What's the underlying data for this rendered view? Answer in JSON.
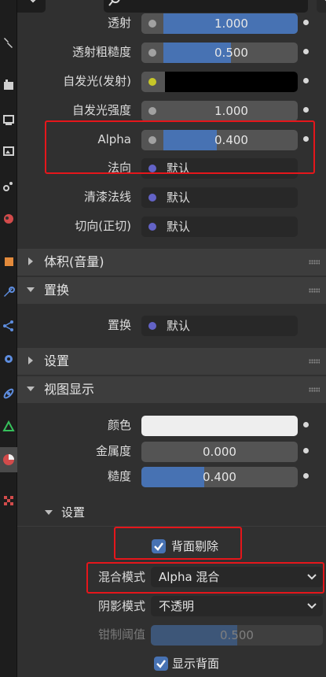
{
  "sidebar": {
    "tabs": [
      {
        "icon": "tool-icon",
        "active": false
      },
      {
        "icon": "render-icon",
        "active": false
      },
      {
        "icon": "output-icon",
        "active": false
      },
      {
        "icon": "view-layer-icon",
        "active": false
      },
      {
        "icon": "scene-icon",
        "active": false
      },
      {
        "icon": "world-icon",
        "active": false
      },
      {
        "icon": "object-icon",
        "active": false
      },
      {
        "icon": "modifier-icon",
        "active": false
      },
      {
        "icon": "particles-icon",
        "active": false
      },
      {
        "icon": "physics-icon",
        "active": false
      },
      {
        "icon": "constraints-icon",
        "active": false
      },
      {
        "icon": "data-icon",
        "active": false
      },
      {
        "icon": "material-icon",
        "active": true
      },
      {
        "icon": "texture-icon",
        "active": false
      }
    ]
  },
  "header": {
    "search_icon": "search-icon"
  },
  "surface": {
    "transmission": {
      "label": "透射",
      "value": "1.000",
      "fraction": 1.0
    },
    "transmission_roughness": {
      "label": "透射粗糙度",
      "value": "0.500",
      "fraction": 0.5
    },
    "emission": {
      "label": "自发光(发射)",
      "color": "#000000"
    },
    "emission_strength": {
      "label": "自发光强度",
      "value": "1.000"
    },
    "alpha": {
      "label": "Alpha",
      "value": "0.400",
      "fraction": 0.4
    },
    "normal": {
      "label": "法向",
      "value": "默认"
    },
    "clearcoat_normal": {
      "label": "清漆法线",
      "value": "默认"
    },
    "tangent": {
      "label": "切向(正切)",
      "value": "默认"
    }
  },
  "panels": {
    "volume": {
      "title": "体积(音量)",
      "expanded": false
    },
    "displacement": {
      "title": "置换",
      "expanded": true
    },
    "settings": {
      "title": "设置",
      "expanded": false
    },
    "viewport_display": {
      "title": "视图显示",
      "expanded": true
    }
  },
  "displacement": {
    "label": "置换",
    "value": "默认"
  },
  "viewport": {
    "color": {
      "label": "颜色",
      "swatch": "#eeeeee"
    },
    "metallic": {
      "label": "金属度",
      "value": "0.000",
      "fraction": 0.0
    },
    "roughness": {
      "label": "糙度",
      "value": "0.400",
      "fraction": 0.4
    }
  },
  "settings_sub": {
    "title": "设置",
    "backface_culling": {
      "label": "背面剔除",
      "checked": true
    },
    "blend_mode": {
      "label": "混合模式",
      "value": "Alpha 混合"
    },
    "shadow_mode": {
      "label": "阴影模式",
      "value": "不透明"
    },
    "clip_threshold": {
      "label": "钳制阈值",
      "value": "0.500",
      "fraction": 0.5,
      "enabled": false
    },
    "show_backface": {
      "label": "显示背面",
      "checked": true
    }
  },
  "colors": {
    "accent": "#4772b3",
    "highlight": "#e5161b"
  }
}
